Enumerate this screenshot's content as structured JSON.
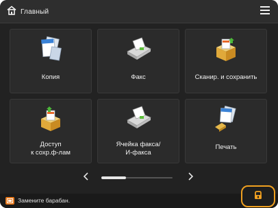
{
  "header": {
    "home_label": "Главный",
    "home_icon": "home-icon",
    "menu_icon": "menu-icon"
  },
  "tiles": [
    {
      "label": "Копия",
      "icon": "copy-icon"
    },
    {
      "label": "Факс",
      "icon": "fax-icon"
    },
    {
      "label": "Сканир. и сохранить",
      "icon": "scan-and-store-icon"
    },
    {
      "label": "Доступ\nк сохр.ф-лам",
      "icon": "access-stored-files-icon"
    },
    {
      "label": "Ячейка факса/\nИ-факса",
      "icon": "fax-inbox-icon"
    },
    {
      "label": "Печать",
      "icon": "print-icon"
    }
  ],
  "pager": {
    "prev_icon": "chevron-left-icon",
    "next_icon": "chevron-right-icon",
    "current_fraction": 0.35
  },
  "status": {
    "icon": "drum-warning-icon",
    "message": "Замените барабан."
  },
  "stop_button": {
    "icon": "stop-icon"
  },
  "colors": {
    "background": "#222222",
    "tile": "#2b2b2b",
    "accent_orange": "#f0a020",
    "warning": "#e8781a"
  }
}
